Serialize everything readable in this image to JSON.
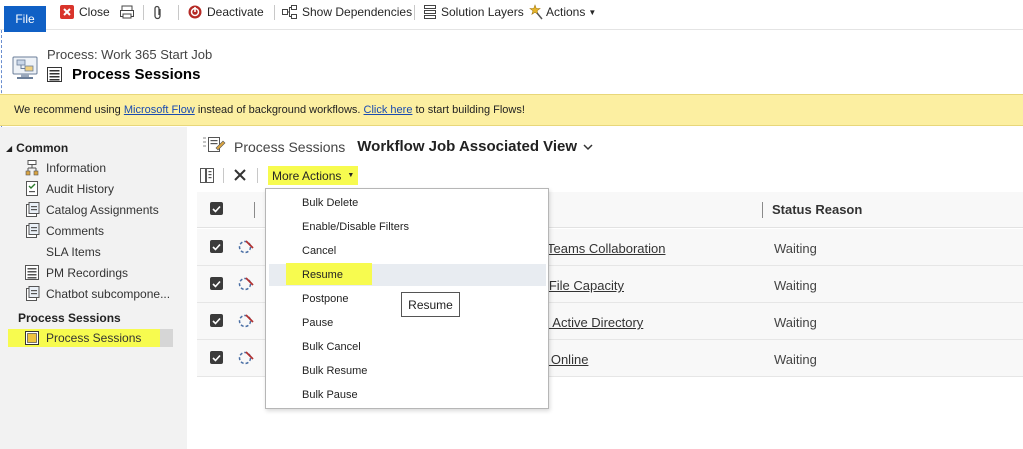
{
  "ribbon": {
    "file": "File",
    "close": "Close",
    "deactivate": "Deactivate",
    "show_dependencies": "Show Dependencies",
    "solution_layers": "Solution Layers",
    "actions": "Actions"
  },
  "header": {
    "process_label": "Process: Work 365 Start Job",
    "page_title": "Process Sessions"
  },
  "notification": {
    "pre": "We recommend using ",
    "link1": "Microsoft Flow",
    "mid": " instead of background workflows. ",
    "link2": "Click here",
    "post": " to start building Flows!"
  },
  "nav": {
    "common": "Common",
    "items": [
      "Information",
      "Audit History",
      "Catalog Assignments",
      "Comments",
      "SLA Items",
      "PM Recordings",
      "Chatbot subcompone..."
    ],
    "process_sessions_group": "Process Sessions",
    "process_sessions_item": "Process Sessions"
  },
  "view": {
    "entity": "Process Sessions",
    "name": "Workflow Job Associated View"
  },
  "toolbar": {
    "more_actions": "More Actions"
  },
  "grid": {
    "status_header": "Status Reason",
    "rows": [
      {
        "name": "t Teams Collaboration",
        "status": "Waiting"
      },
      {
        "name": "e File Capacity",
        "status": "Waiting"
      },
      {
        "name": "D Active Directory",
        "status": "Waiting"
      },
      {
        "name": "5 Online",
        "status": "Waiting"
      }
    ]
  },
  "menu": {
    "items": [
      "Bulk Delete",
      "Enable/Disable Filters",
      "Cancel",
      "Resume",
      "Postpone",
      "Pause",
      "Bulk Cancel",
      "Bulk Resume",
      "Bulk Pause"
    ]
  },
  "tooltip": "Resume",
  "colors": {
    "highlight": "#f7fb4f",
    "file_tab": "#1060c5",
    "notification": "#fcefa1"
  }
}
